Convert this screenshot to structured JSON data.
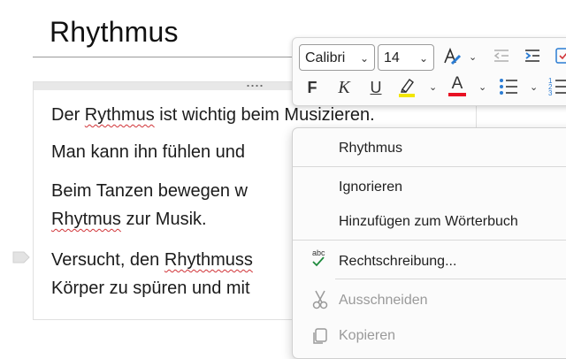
{
  "page": {
    "title": "Rhythmus"
  },
  "note": {
    "paragraphs": [
      {
        "parts": [
          {
            "t": "Der "
          },
          {
            "t": "Rythmus",
            "err": true
          },
          {
            "t": " ist wichtig beim Musizieren."
          }
        ]
      },
      {
        "parts": [
          {
            "t": "Man kann ihn fühlen und"
          }
        ]
      },
      {
        "parts": [
          {
            "t": "Beim Tanzen bewegen w"
          }
        ]
      },
      {
        "parts": [
          {
            "t": "Rhytmus",
            "err": true
          },
          {
            "t": " zur Musik."
          }
        ]
      },
      {
        "parts": [
          {
            "t": "Versucht, den "
          },
          {
            "t": "Rhythmuss",
            "err": true
          }
        ]
      },
      {
        "parts": [
          {
            "t": "Körper zu spüren und mit"
          }
        ]
      }
    ]
  },
  "toolbar": {
    "font_name": "Calibri",
    "font_size": "14",
    "bold_label": "F",
    "italic_label": "K",
    "underline_label": "U",
    "font_color_label": "A",
    "highlight_color": "#f2e600",
    "font_color": "#e81123"
  },
  "context_menu": {
    "suggestion": "Rhythmus",
    "ignore": "Ignorieren",
    "add_dictionary": "Hinzufügen zum Wörterbuch",
    "spelling": "Rechtschreibung...",
    "spelling_icon_text": "abc",
    "cut": "Ausschneiden",
    "copy": "Kopieren"
  }
}
